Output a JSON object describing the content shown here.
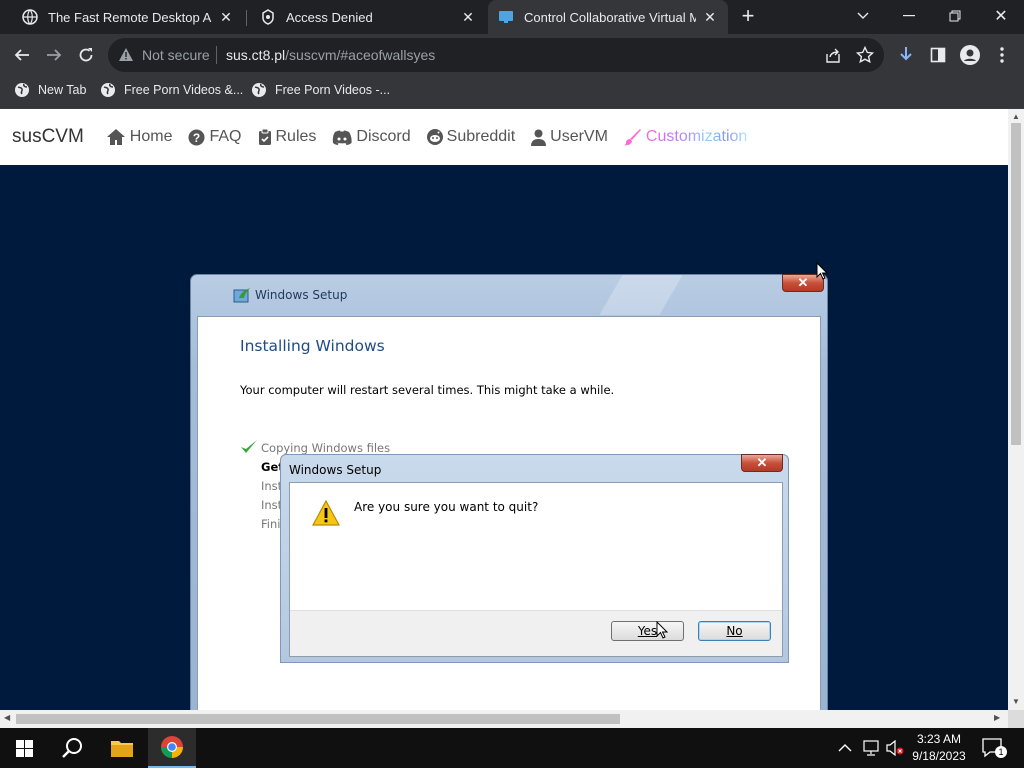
{
  "browser": {
    "tabs": [
      {
        "title": "The Fast Remote Desktop Application",
        "active": false
      },
      {
        "title": "Access Denied",
        "active": false
      },
      {
        "title": "Control Collaborative Virtual Machines",
        "active": true
      }
    ],
    "new_tab_symbol": "+",
    "address": {
      "security_label": "Not secure",
      "host": "sus.ct8.pl",
      "path": "/suscvm/#aceofwallsyes"
    },
    "bookmarks": [
      {
        "label": "New Tab",
        "icon": "globe-icon"
      },
      {
        "label": "Free Porn Videos &...",
        "icon": "globe-icon"
      },
      {
        "label": "Free Porn Videos -...",
        "icon": "globe-icon"
      }
    ]
  },
  "site": {
    "brand": "susCVM",
    "nav": [
      {
        "label": "Home",
        "icon": "home-icon"
      },
      {
        "label": "FAQ",
        "icon": "question-icon"
      },
      {
        "label": "Rules",
        "icon": "clipboard-icon"
      },
      {
        "label": "Discord",
        "icon": "discord-icon"
      },
      {
        "label": "Subreddit",
        "icon": "reddit-icon"
      },
      {
        "label": "UserVM",
        "icon": "user-icon"
      },
      {
        "label": "Customization",
        "icon": "brush-icon"
      }
    ]
  },
  "vm": {
    "setup_window": {
      "title": "Windows Setup",
      "heading": "Installing Windows",
      "description": "Your computer will restart several times. This might take a while.",
      "steps": [
        {
          "label": "Copying Windows files",
          "status": "done"
        },
        {
          "label": "Get",
          "status": "current"
        },
        {
          "label": "Inst",
          "status": "pending"
        },
        {
          "label": "Inst",
          "status": "pending"
        },
        {
          "label": "Fini",
          "status": "pending"
        }
      ]
    },
    "quit_dialog": {
      "title": "Windows Setup",
      "message": "Are you sure you want to quit?",
      "yes_label": "Yes",
      "no_label": "No",
      "icon": "warning-icon"
    }
  },
  "taskbar": {
    "time": "3:23 AM",
    "date": "9/18/2023",
    "notification_count": "1"
  },
  "colors": {
    "vm_background": "#001a3d",
    "browser_dark": "#202124",
    "toolbar": "#35363a"
  }
}
